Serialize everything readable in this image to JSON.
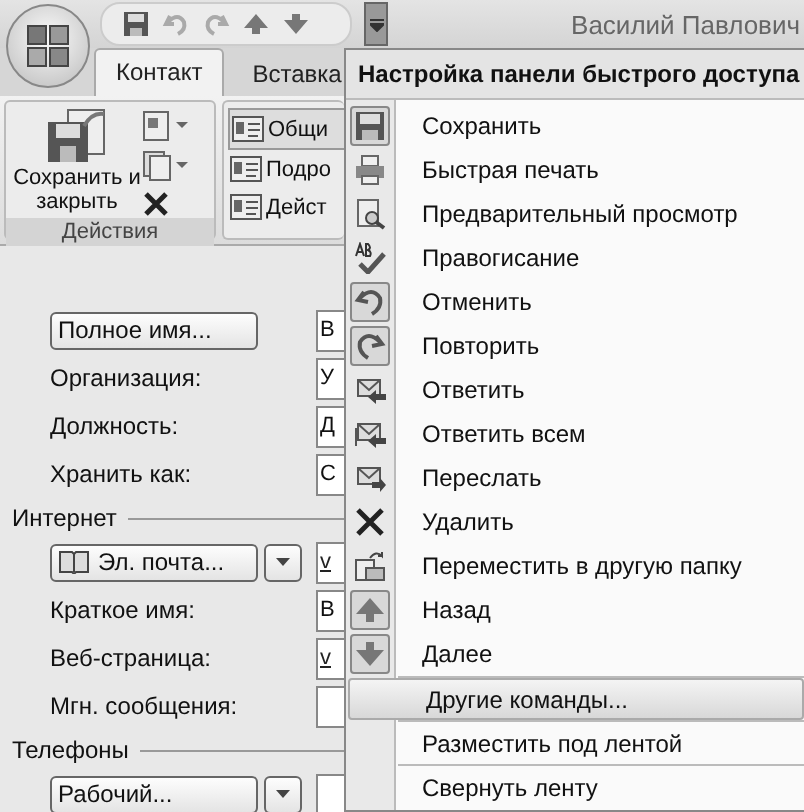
{
  "window": {
    "title": "Василий Павлович"
  },
  "tabs": [
    {
      "label": "Контакт",
      "selected": true
    },
    {
      "label": "Вставка",
      "selected": false
    }
  ],
  "ribbon": {
    "actions_group": {
      "label": "Действия",
      "save_close": "Сохранить и закрыть"
    },
    "show_group": {
      "items": [
        {
          "label": "Общи",
          "selected": true
        },
        {
          "label": "Подро",
          "selected": false
        },
        {
          "label": "Дейст",
          "selected": false
        }
      ]
    }
  },
  "form": {
    "sections": [
      {
        "rows": [
          {
            "kind": "button",
            "label": "Полное имя...",
            "value": "В",
            "link": false
          },
          {
            "kind": "label",
            "label": "Организация:",
            "value": "У",
            "link": false
          },
          {
            "kind": "label",
            "label": "Должность:",
            "value": "Д",
            "link": false
          },
          {
            "kind": "label",
            "label": "Хранить как:",
            "value": "С",
            "link": false
          }
        ]
      },
      {
        "title": "Интернет",
        "rows": [
          {
            "kind": "dropdown-button",
            "label": "Эл. почта...",
            "value": "v",
            "link": true
          },
          {
            "kind": "label",
            "label": "Краткое имя:",
            "value": "В",
            "link": false
          },
          {
            "kind": "label",
            "label": "Веб-страница:",
            "value": "v",
            "link": true
          },
          {
            "kind": "label",
            "label": "Мгн. сообщения:"
          }
        ]
      },
      {
        "title": "Телефоны",
        "rows": [
          {
            "kind": "dropdown-button",
            "label": "Рабочий..."
          }
        ]
      }
    ]
  },
  "menu": {
    "title": "Настройка панели быстрого доступа",
    "items": [
      {
        "kind": "command",
        "label": "Сохранить",
        "checked": true,
        "selected": false
      },
      {
        "kind": "command",
        "label": "Быстрая печать",
        "checked": false,
        "selected": false
      },
      {
        "kind": "command",
        "label": "Предварительный просмотр",
        "checked": false,
        "selected": false
      },
      {
        "kind": "command",
        "label": "Правогисание",
        "checked": false,
        "selected": false
      },
      {
        "kind": "command",
        "label": "Отменить",
        "checked": true,
        "selected": false
      },
      {
        "kind": "command",
        "label": "Повторить",
        "checked": true,
        "selected": false
      },
      {
        "kind": "command",
        "label": "Ответить",
        "checked": false,
        "selected": false
      },
      {
        "kind": "command",
        "label": "Ответить всем",
        "checked": false,
        "selected": false
      },
      {
        "kind": "command",
        "label": "Переслать",
        "checked": false,
        "selected": false
      },
      {
        "kind": "command",
        "label": "Удалить",
        "checked": false,
        "selected": false
      },
      {
        "kind": "command",
        "label": "Переместить в другую папку",
        "checked": false,
        "selected": false
      },
      {
        "kind": "command",
        "label": "Назад",
        "checked": true,
        "selected": false
      },
      {
        "kind": "command",
        "label": "Далее",
        "checked": true,
        "selected": false
      },
      {
        "kind": "option",
        "label": "Другие команды...",
        "selected": true
      },
      {
        "kind": "option",
        "label": "Разместить под лентой",
        "selected": false
      },
      {
        "kind": "option",
        "label": "Свернуть ленту",
        "selected": false
      }
    ]
  }
}
